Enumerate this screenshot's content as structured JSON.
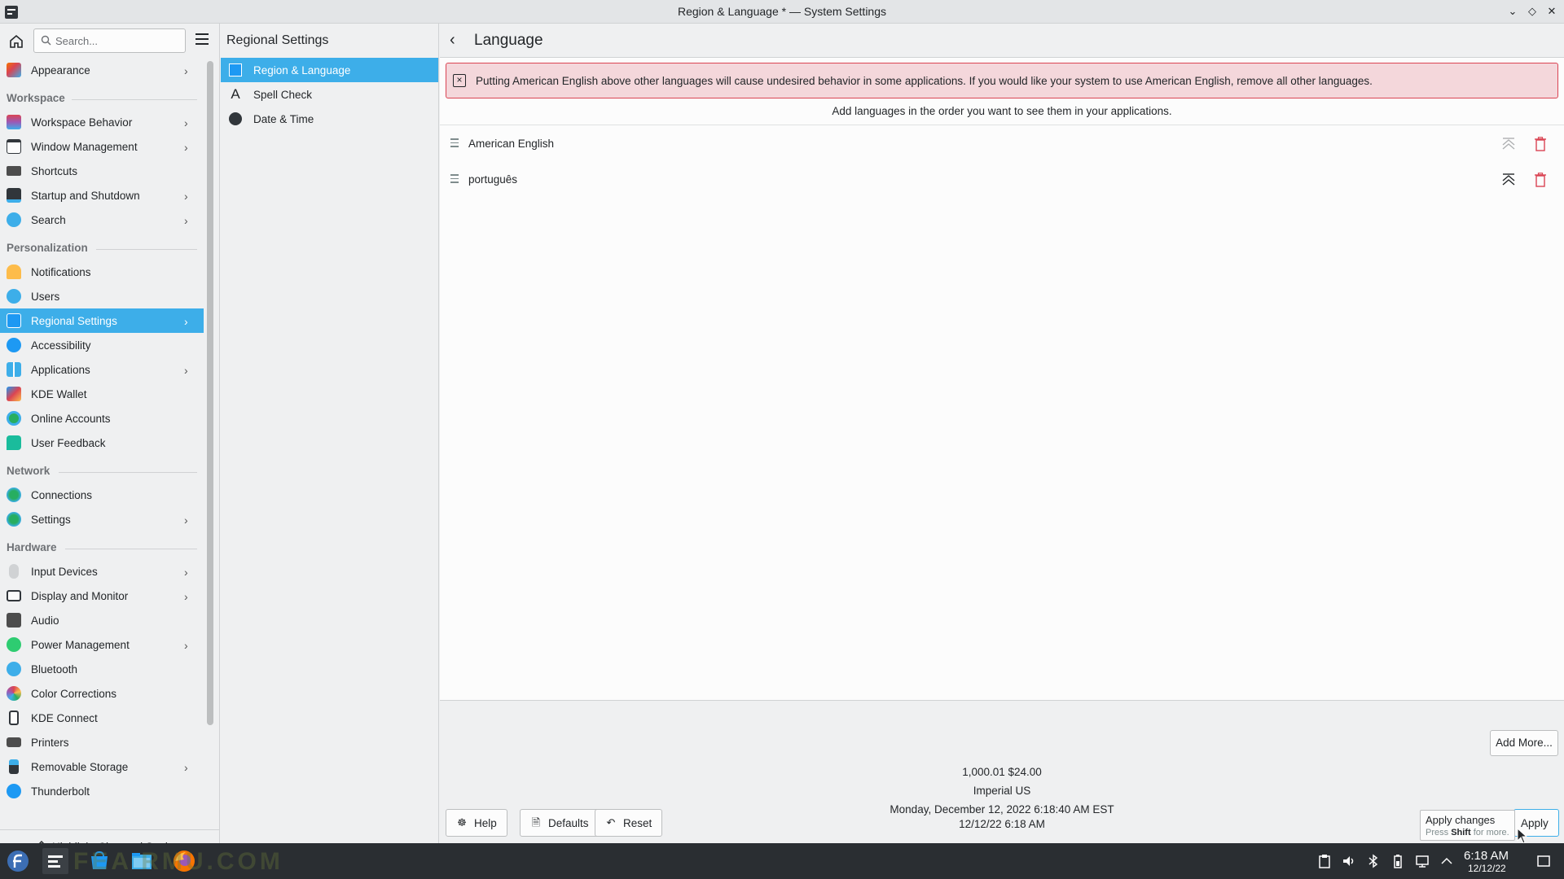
{
  "window": {
    "title": "Region & Language * — System Settings"
  },
  "search": {
    "placeholder": "Search..."
  },
  "sidebar": {
    "appearance": "Appearance",
    "workspace": {
      "header": "Workspace",
      "items": [
        "Workspace Behavior",
        "Window Management",
        "Shortcuts",
        "Startup and Shutdown",
        "Search"
      ]
    },
    "personalization": {
      "header": "Personalization",
      "items": [
        "Notifications",
        "Users",
        "Regional Settings",
        "Accessibility",
        "Applications",
        "KDE Wallet",
        "Online Accounts",
        "User Feedback"
      ]
    },
    "network": {
      "header": "Network",
      "items": [
        "Connections",
        "Settings"
      ]
    },
    "hardware": {
      "header": "Hardware",
      "items": [
        "Input Devices",
        "Display and Monitor",
        "Audio",
        "Power Management",
        "Bluetooth",
        "Color Corrections",
        "KDE Connect",
        "Printers",
        "Removable Storage",
        "Thunderbolt"
      ]
    },
    "highlight_label": "Highlight Changed Settings"
  },
  "middle": {
    "title": "Regional Settings",
    "items": [
      "Region & Language",
      "Spell Check",
      "Date & Time"
    ]
  },
  "main": {
    "title": "Language",
    "warning": "Putting American English above other languages will cause undesired behavior in some applications. If you would like your system to use American English, remove all other languages.",
    "hint": "Add languages in the order you want to see them in your applications.",
    "languages": [
      "American English",
      "português"
    ],
    "add_more": "Add More...",
    "example_number": "1,000.01  $24.00",
    "example_measure": "Imperial US",
    "example_date_long": "Monday, December 12, 2022 6:18:40 AM EST",
    "example_date_short": "12/12/22 6:18 AM",
    "help": "Help",
    "defaults": "Defaults",
    "reset": "Reset",
    "apply": "Apply",
    "tooltip_title": "Apply changes",
    "tooltip_pre": "Press ",
    "tooltip_key": "Shift",
    "tooltip_post": " for more."
  },
  "taskbar": {
    "watermark": "FEA RMU.COM",
    "time": "6:18 AM",
    "date": "12/12/22"
  },
  "colors": {
    "accent": "#3daee9",
    "warning_bg": "#f4d7db",
    "warning_border": "#da4453",
    "delete": "#da4453"
  }
}
